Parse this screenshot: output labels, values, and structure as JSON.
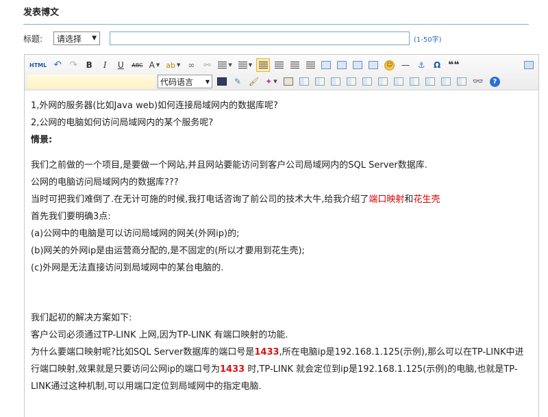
{
  "page": {
    "title": "发表博文"
  },
  "title_row": {
    "label": "标题:",
    "category": "请选择",
    "input_value": "",
    "hint": "(1-50字)"
  },
  "toolbar": {
    "html_label": "HTML",
    "bold": "B",
    "italic": "I",
    "underline": "U",
    "strike": "ABC",
    "font_color": "A",
    "highlight": "ab",
    "lang_select": "代码语言",
    "omega": "Ω",
    "quote": "66",
    "help": "?"
  },
  "content": {
    "line1": "1,外网的服务器(比如Java web)如何连接局域网内的数据库呢?",
    "line2": "2,公网的电脑如何访问局域网内的某个服务呢?",
    "scenario": "情景:",
    "p1": "我们之前做的一个项目,是要做一个网站,并且网站要能访问到客户公司局域网内的SQL Server数据库.",
    "p2": "公网的电脑访问局域网内的数据库???",
    "p3_a": "当时可把我们难倒了.在无计可施的时候,我打电话咨询了前公司的技术大牛,给我介绍了",
    "p3_b": "端口映射",
    "p3_c": "和",
    "p3_d": "花生壳",
    "p4": "首先我们要明确3点:",
    "p5": "(a)公网中的电脑是可以访问局域网的网关(外网ip)的;",
    "p6": "(b)网关的外网ip是由运营商分配的,是不固定的(所以才要用到花生壳);",
    "p7": "(c)外网是无法直接访问到局域网中的某台电脑的.",
    "p8": "我们起初的解决方案如下:",
    "p9": "客户公司必须通过TP-LINK 上网,因为TP-LINK 有端口映射的功能.",
    "p10_a": "为什么要端口映射呢?比如SQL Server数据库的端口号是",
    "port": "1433",
    "p10_b": ",所在电脑ip是192.168.1.125(示例),那么可以在TP-LINK中进行端口映射,效果就是只要访问公网ip的端口号为",
    "p10_c": " 时,TP-LINK 就会定位到ip是192.168.1.125(示例)的电脑,也就是TP-LINK通过这种机制,可以用端口定位到局域网中的指定电脑."
  },
  "colors": {
    "accent": "#7bb3c4",
    "link_red": "#d40000",
    "hint_blue": "#2a6ab0"
  }
}
